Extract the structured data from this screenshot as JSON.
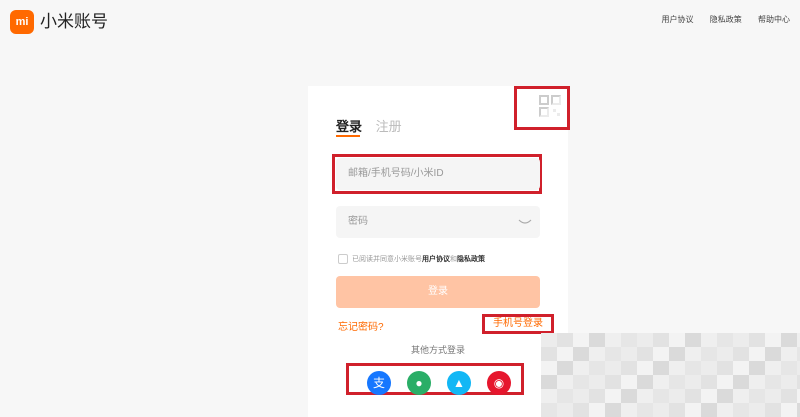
{
  "header": {
    "logo_mark": "mi",
    "app_title": "小米账号",
    "links": [
      "用户协议",
      "隐私政策",
      "帮助中心"
    ]
  },
  "tabs": {
    "login": "登录",
    "register": "注册"
  },
  "form": {
    "account_placeholder": "邮箱/手机号码/小米ID",
    "password_placeholder": "密码",
    "agreement_prefix": "已阅读并同意小米账号",
    "agreement_terms": "用户协议",
    "agreement_and": "和",
    "agreement_privacy": "隐私政策",
    "login_button": "登录",
    "forgot_password": "忘记密码?",
    "phone_login": "手机号登录",
    "other_methods": "其他方式登录"
  },
  "social": [
    {
      "name": "alipay-icon",
      "glyph": "支",
      "color": "#1677ff"
    },
    {
      "name": "wechat-icon",
      "glyph": "●",
      "color": "#2aae67"
    },
    {
      "name": "qq-icon",
      "glyph": "▲",
      "color": "#12b7f5"
    },
    {
      "name": "weibo-icon",
      "glyph": "◉",
      "color": "#e6162d"
    }
  ],
  "colors": {
    "brand": "#ff6900",
    "highlight_box": "#d0202b",
    "login_button_disabled": "#ffc4a4"
  }
}
